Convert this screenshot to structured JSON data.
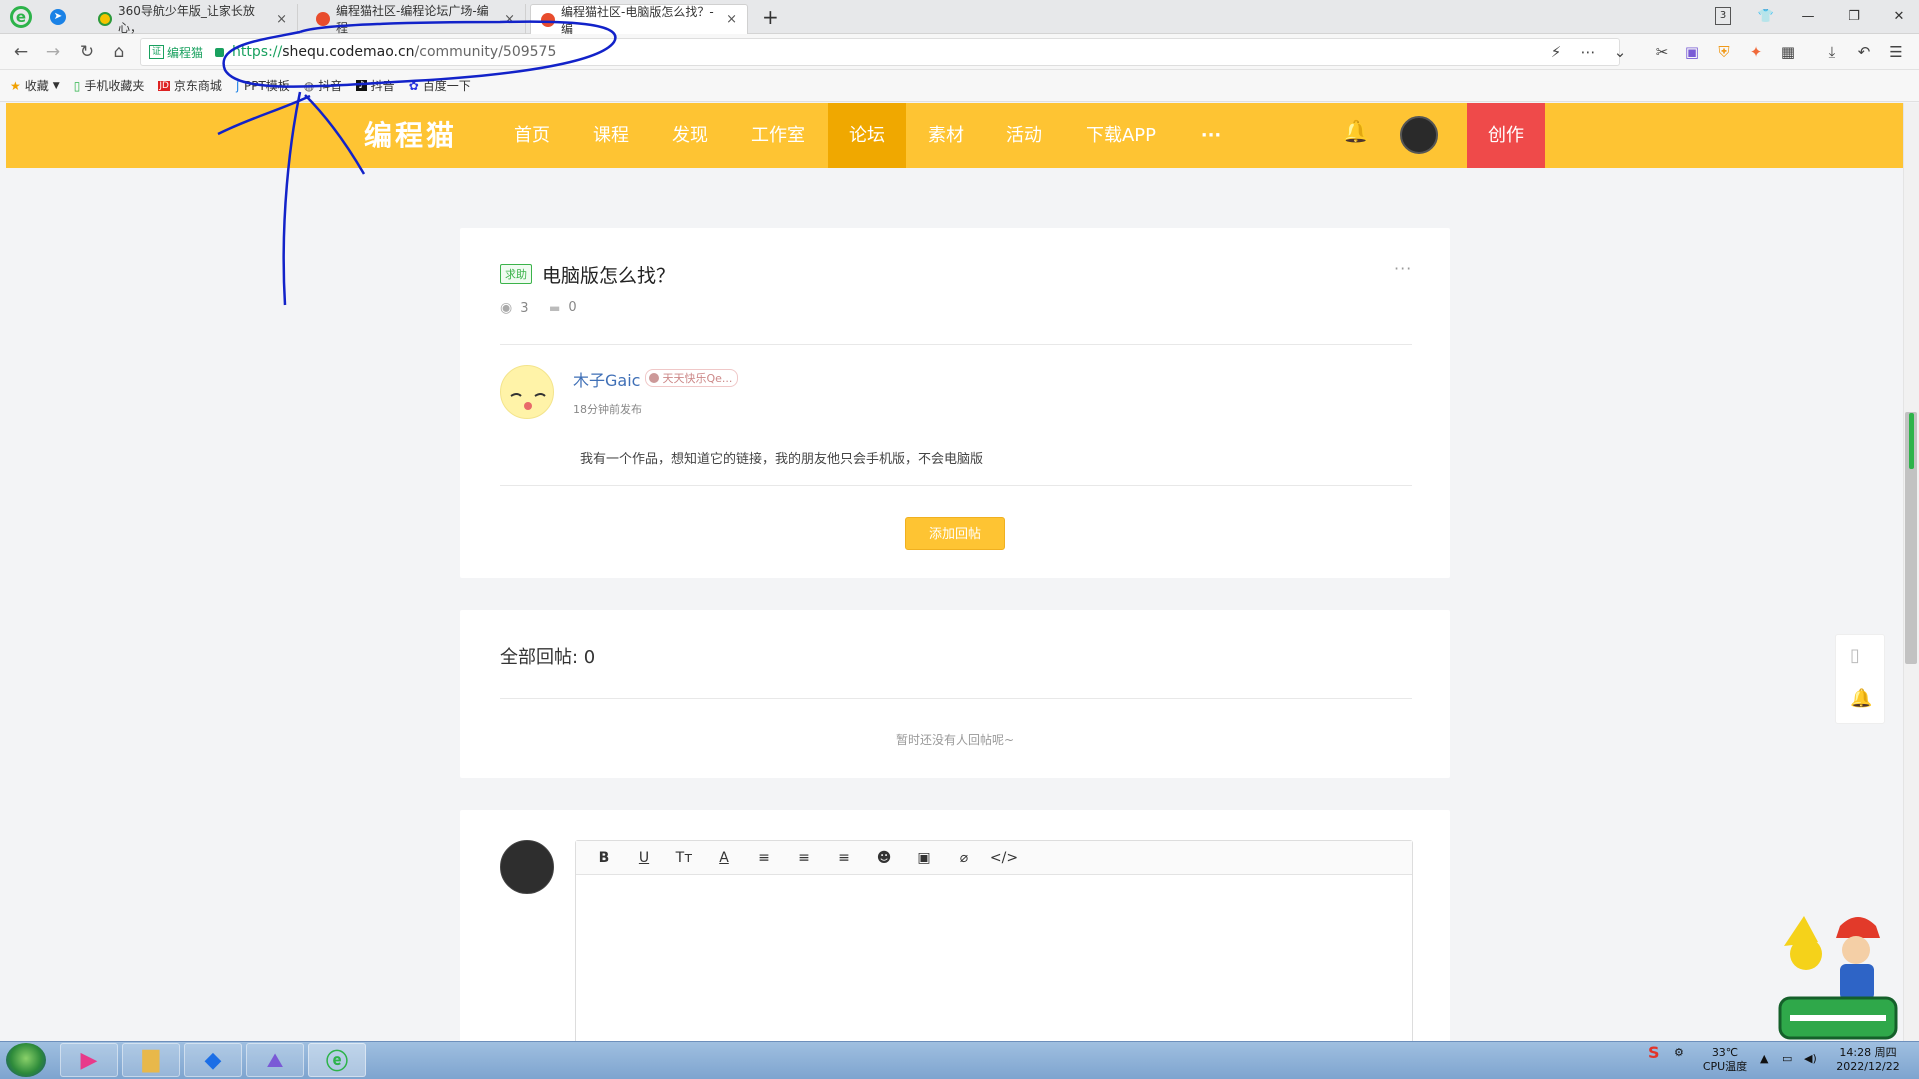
{
  "browser": {
    "tabs": [
      {
        "title": "360导航少年版_让家长放心，",
        "close": "×"
      },
      {
        "title": "编程猫社区-编程论坛广场-编程",
        "close": "×"
      },
      {
        "title": "编程猫社区-电脑版怎么找？-编",
        "close": "×"
      }
    ],
    "new_tab": "+",
    "tab_count": "3",
    "window_controls": [
      "—",
      "❐",
      "✕"
    ],
    "site_label": "编程猫",
    "site_badge": "证",
    "url_scheme": "https://",
    "url_host": "shequ.codemao.cn",
    "url_path": "/community/509575",
    "nav_icons": [
      "back-icon",
      "forward-icon",
      "refresh-icon",
      "home-icon"
    ],
    "bookmarks": [
      {
        "label": "收藏",
        "icon": "star-icon"
      },
      {
        "label": "手机收藏夹",
        "icon": "phone-icon"
      },
      {
        "label": "京东商城",
        "icon": "jd-icon"
      },
      {
        "label": "PPT模板",
        "icon": "ppt-icon"
      },
      {
        "label": "抖音",
        "icon": "globe-icon"
      },
      {
        "label": "抖音",
        "icon": "tiktok-icon"
      },
      {
        "label": "百度一下",
        "icon": "baidu-icon"
      }
    ]
  },
  "site": {
    "logo": "编程猫",
    "nav": [
      {
        "label": "首页",
        "active": false
      },
      {
        "label": "课程",
        "active": false
      },
      {
        "label": "发现",
        "active": false
      },
      {
        "label": "工作室",
        "active": false
      },
      {
        "label": "论坛",
        "active": true
      },
      {
        "label": "素材",
        "active": false
      },
      {
        "label": "活动",
        "active": false
      },
      {
        "label": "下载APP",
        "active": false
      }
    ],
    "more": "···",
    "create": "创作",
    "brand_color": "#fec433",
    "create_color": "#ef4a4a"
  },
  "post": {
    "tag": "求助",
    "title": "电脑版怎么找？",
    "more": "···",
    "views": "3",
    "comments": "0",
    "author": "木子Gaic",
    "badge": "天天快乐Qe...",
    "time": "18分钟前发布",
    "body": "我有一个作品，想知道它的链接，我的朋友他只会手机版，不会电脑版",
    "reply_button": "添加回帖"
  },
  "replies": {
    "count_label": "全部回帖: 0",
    "empty": "暂时还没有人回帖呢~"
  },
  "editor": {
    "tools": [
      "B",
      "U",
      "Tт",
      "A",
      "≡",
      "≡",
      "≡",
      "☻",
      "▣",
      "⌀",
      "</>"
    ],
    "tool_names": [
      "bold-icon",
      "underline-icon",
      "font-size-icon",
      "font-color-icon",
      "align-left-icon",
      "align-center-icon",
      "align-right-icon",
      "emoji-cat-icon",
      "image-icon",
      "attachment-icon",
      "code-icon"
    ]
  },
  "taskbar": {
    "temp": "33℃",
    "temp_label": "CPU温度",
    "time": "14:28 周四",
    "date": "2022/12/22"
  }
}
